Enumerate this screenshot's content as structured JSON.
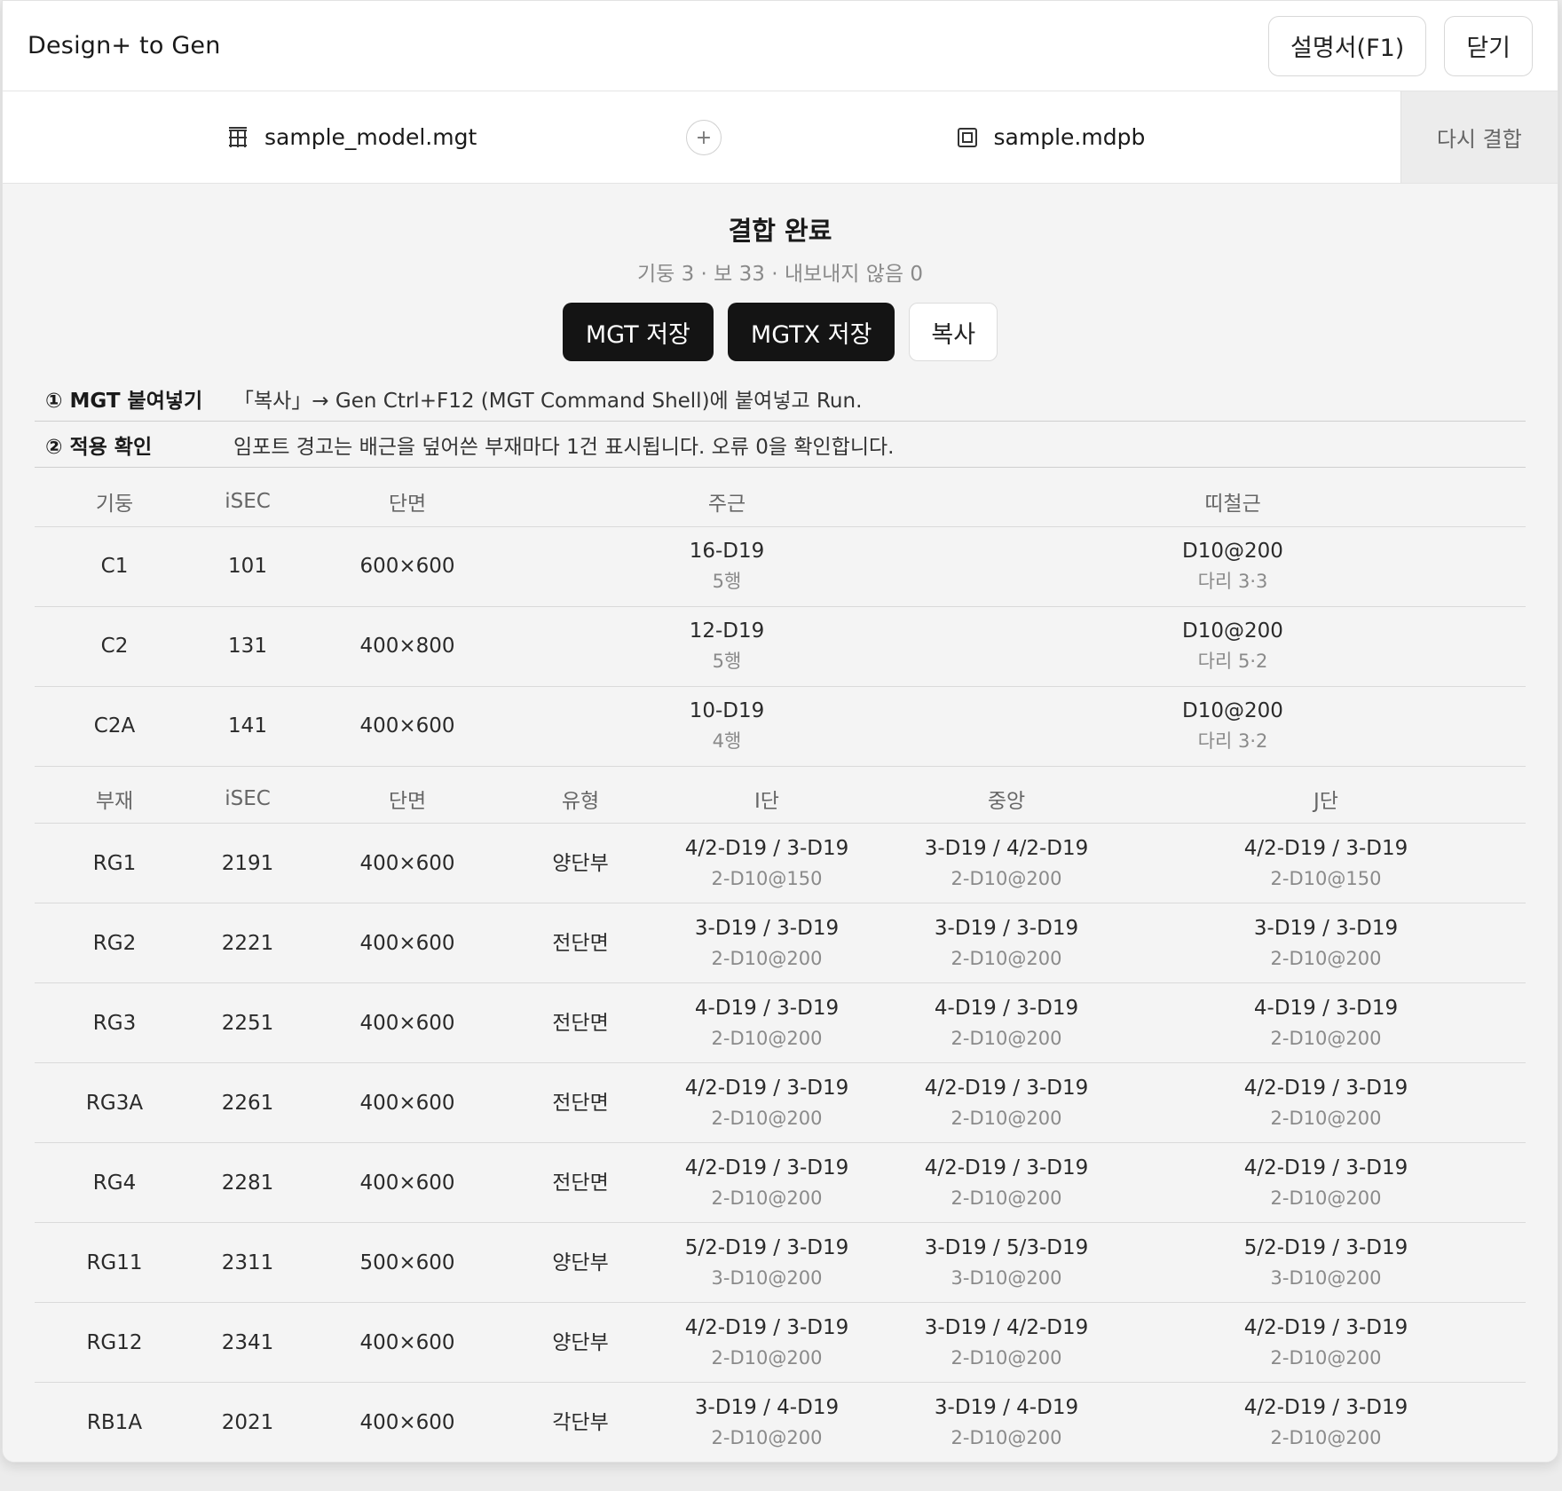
{
  "app": {
    "title": "Design+ to Gen",
    "manual_button": "설명서(F1)",
    "close_button": "닫기"
  },
  "files": {
    "left": "sample_model.mgt",
    "plus": "+",
    "right": "sample.mdpb",
    "rejoin_button": "다시 결합"
  },
  "result": {
    "title": "결합 완료",
    "subtitle": "기둥 3 · 보 33 · 내보내지 않음 0",
    "save_mgt": "MGT 저장",
    "save_mgtx": "MGTX 저장",
    "copy": "복사"
  },
  "steps": [
    {
      "label": "① MGT 붙여넣기",
      "text": "「복사」→ Gen Ctrl+F12 (MGT Command Shell)에 붙여넣고 Run."
    },
    {
      "label": "② 적용 확인",
      "text": "임포트 경고는 배근을 덮어쓴 부재마다 1건 표시됩니다. 오류 0을 확인합니다."
    }
  ],
  "columns_table": {
    "headers": [
      "기둥",
      "iSEC",
      "단면",
      "주근",
      "띠철근"
    ],
    "rows": [
      {
        "name": "C1",
        "isec": "101",
        "section": "600×600",
        "main": "16-D19",
        "main_sub": "5행",
        "tie": "D10@200",
        "tie_sub": "다리 3·3"
      },
      {
        "name": "C2",
        "isec": "131",
        "section": "400×800",
        "main": "12-D19",
        "main_sub": "5행",
        "tie": "D10@200",
        "tie_sub": "다리 5·2"
      },
      {
        "name": "C2A",
        "isec": "141",
        "section": "400×600",
        "main": "10-D19",
        "main_sub": "4행",
        "tie": "D10@200",
        "tie_sub": "다리 3·2"
      }
    ]
  },
  "beams_table": {
    "headers": [
      "부재",
      "iSEC",
      "단면",
      "유형",
      "I단",
      "중앙",
      "J단"
    ],
    "rows": [
      {
        "name": "RG1",
        "isec": "2191",
        "section": "400×600",
        "type": "양단부",
        "i": "4/2-D19 / 3-D19",
        "i_sub": "2-D10@150",
        "m": "3-D19 / 4/2-D19",
        "m_sub": "2-D10@200",
        "j": "4/2-D19 / 3-D19",
        "j_sub": "2-D10@150"
      },
      {
        "name": "RG2",
        "isec": "2221",
        "section": "400×600",
        "type": "전단면",
        "i": "3-D19 / 3-D19",
        "i_sub": "2-D10@200",
        "m": "3-D19 / 3-D19",
        "m_sub": "2-D10@200",
        "j": "3-D19 / 3-D19",
        "j_sub": "2-D10@200"
      },
      {
        "name": "RG3",
        "isec": "2251",
        "section": "400×600",
        "type": "전단면",
        "i": "4-D19 / 3-D19",
        "i_sub": "2-D10@200",
        "m": "4-D19 / 3-D19",
        "m_sub": "2-D10@200",
        "j": "4-D19 / 3-D19",
        "j_sub": "2-D10@200"
      },
      {
        "name": "RG3A",
        "isec": "2261",
        "section": "400×600",
        "type": "전단면",
        "i": "4/2-D19 / 3-D19",
        "i_sub": "2-D10@200",
        "m": "4/2-D19 / 3-D19",
        "m_sub": "2-D10@200",
        "j": "4/2-D19 / 3-D19",
        "j_sub": "2-D10@200"
      },
      {
        "name": "RG4",
        "isec": "2281",
        "section": "400×600",
        "type": "전단면",
        "i": "4/2-D19 / 3-D19",
        "i_sub": "2-D10@200",
        "m": "4/2-D19 / 3-D19",
        "m_sub": "2-D10@200",
        "j": "4/2-D19 / 3-D19",
        "j_sub": "2-D10@200"
      },
      {
        "name": "RG11",
        "isec": "2311",
        "section": "500×600",
        "type": "양단부",
        "i": "5/2-D19 / 3-D19",
        "i_sub": "3-D10@200",
        "m": "3-D19 / 5/3-D19",
        "m_sub": "3-D10@200",
        "j": "5/2-D19 / 3-D19",
        "j_sub": "3-D10@200"
      },
      {
        "name": "RG12",
        "isec": "2341",
        "section": "400×600",
        "type": "양단부",
        "i": "4/2-D19 / 3-D19",
        "i_sub": "2-D10@200",
        "m": "3-D19 / 4/2-D19",
        "m_sub": "2-D10@200",
        "j": "4/2-D19 / 3-D19",
        "j_sub": "2-D10@200"
      },
      {
        "name": "RB1A",
        "isec": "2021",
        "section": "400×600",
        "type": "각단부",
        "i": "3-D19 / 4-D19",
        "i_sub": "2-D10@200",
        "m": "3-D19 / 4-D19",
        "m_sub": "2-D10@200",
        "j": "4/2-D19 / 3-D19",
        "j_sub": "2-D10@200"
      }
    ]
  }
}
